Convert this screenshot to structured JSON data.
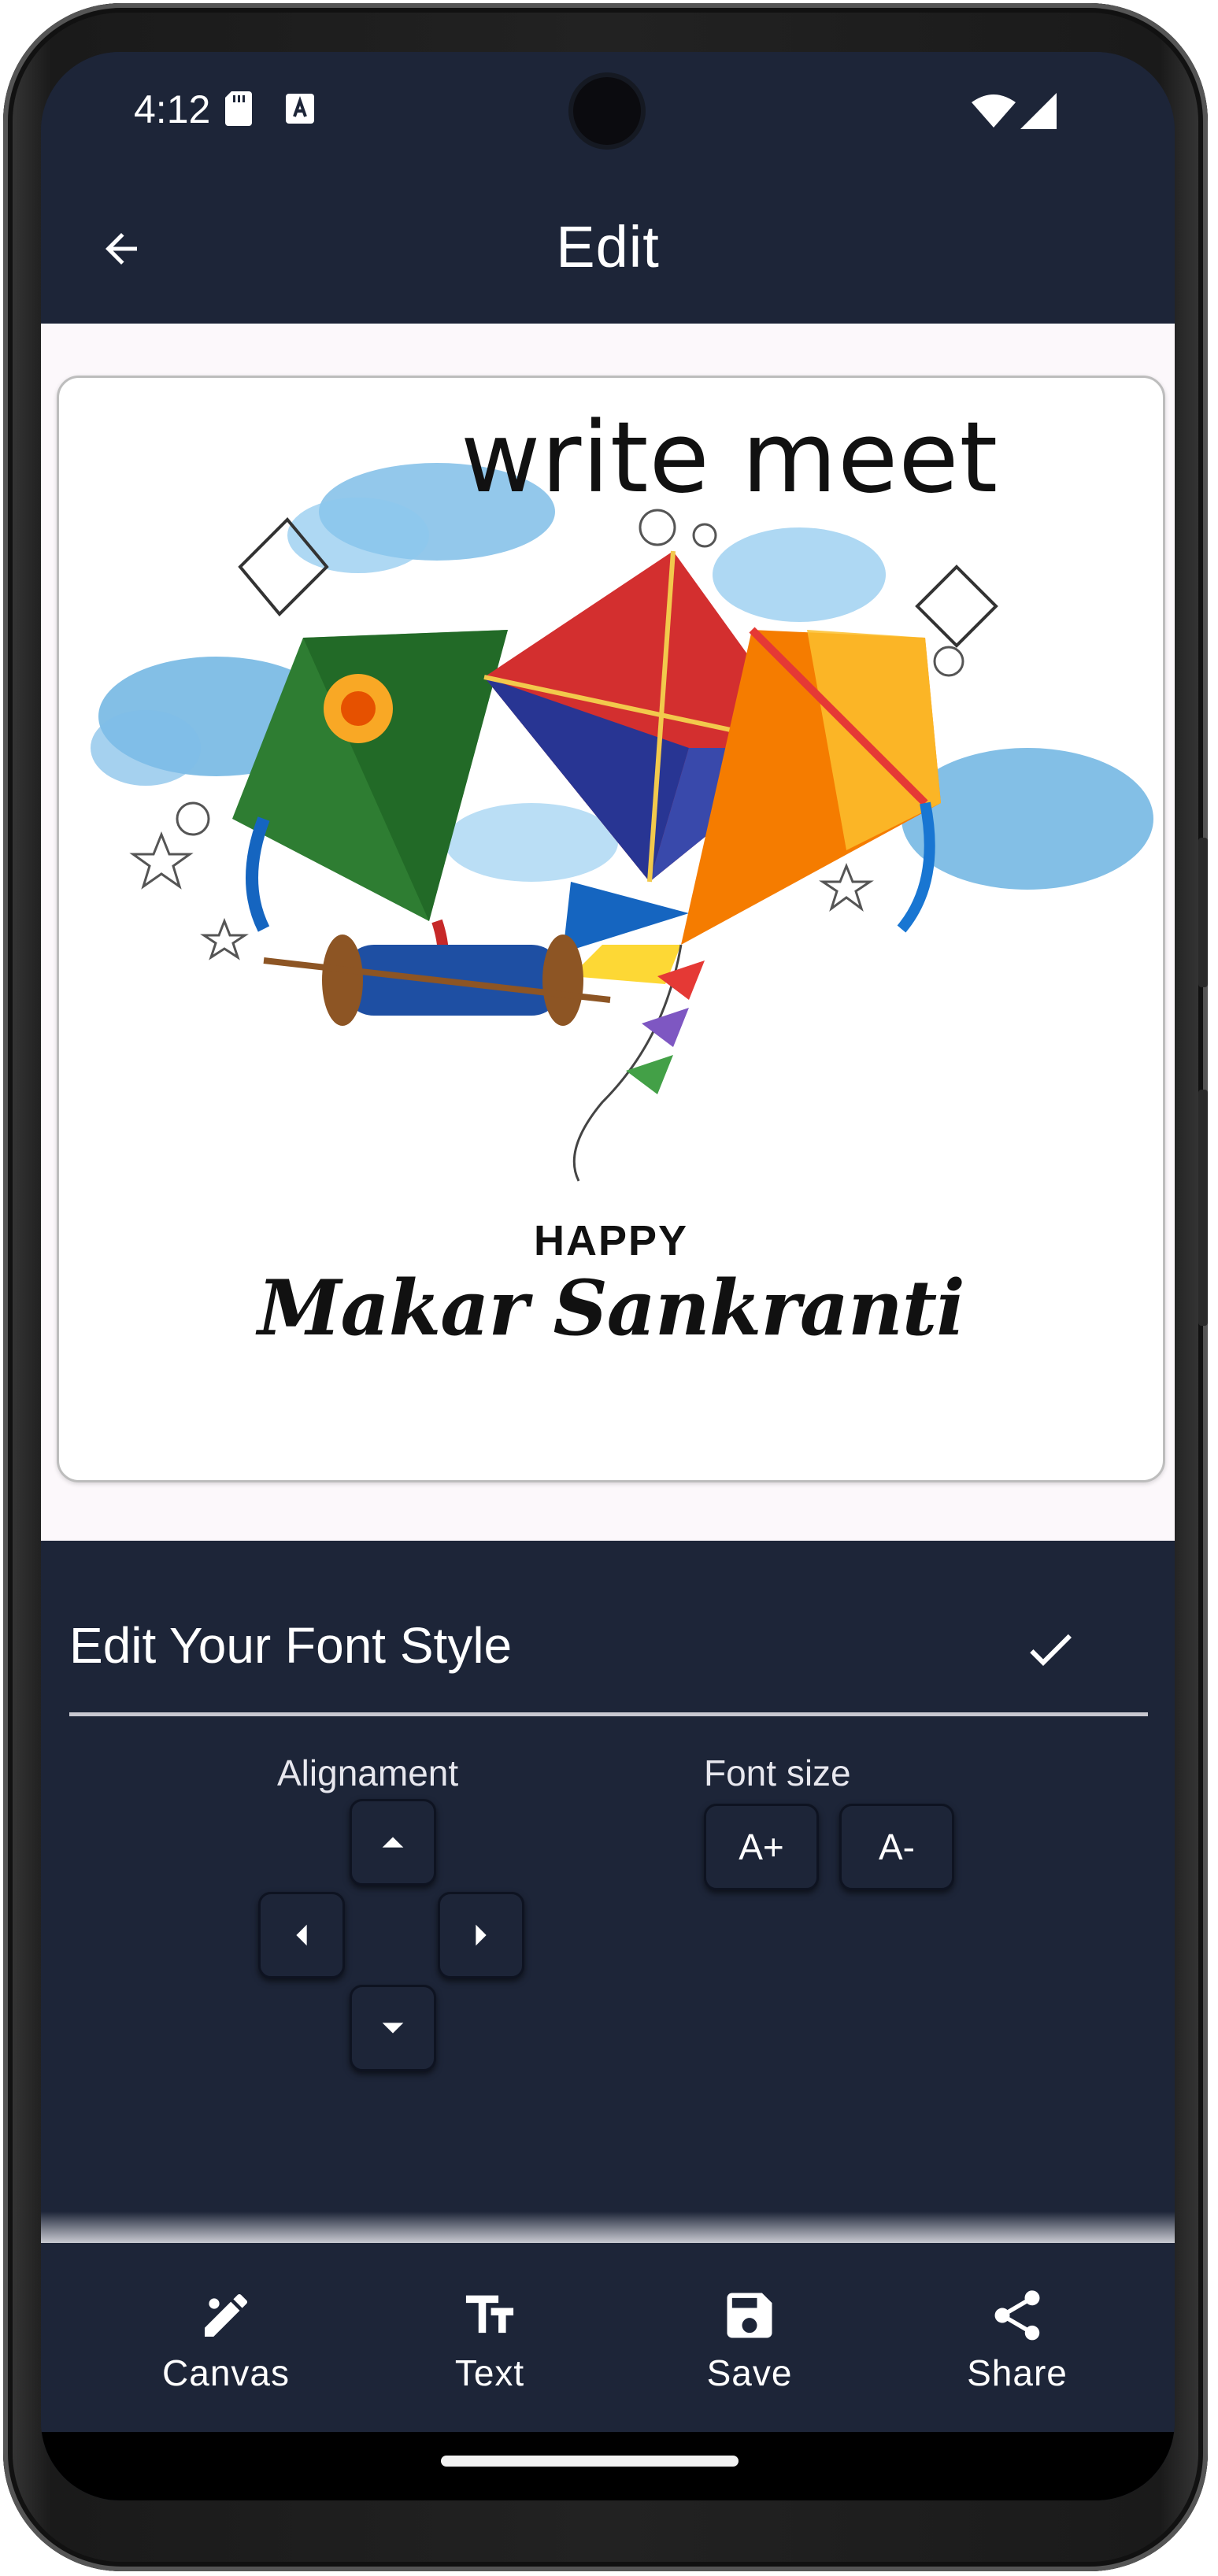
{
  "status_bar": {
    "time": "4:12",
    "icons": [
      "sd-card-icon",
      "a-badge-icon",
      "wifi-icon",
      "cell-signal-icon"
    ]
  },
  "app_bar": {
    "title": "Edit",
    "back_icon": "arrow-left-icon"
  },
  "card": {
    "overlay_text": "write meet",
    "greeting_line1": "HAPPY",
    "greeting_line2": "Makar Sankranti"
  },
  "sheet": {
    "title": "Edit Your Font Style",
    "confirm_icon": "check-icon",
    "alignment_label": "Alignament",
    "alignment_buttons": [
      "arrow-up-icon",
      "arrow-left-icon",
      "arrow-right-icon",
      "arrow-down-icon"
    ],
    "font_size_label": "Font size",
    "increase_label": "A+",
    "decrease_label": "A-"
  },
  "bottom_nav": {
    "items": [
      {
        "label": "Canvas",
        "icon": "draw-icon"
      },
      {
        "label": "Text",
        "icon": "text-fields-icon"
      },
      {
        "label": "Save",
        "icon": "save-icon"
      },
      {
        "label": "Share",
        "icon": "share-icon"
      }
    ]
  },
  "colors": {
    "primary_dark": "#1d2538",
    "background": "#fcf8fb",
    "card": "#ffffff"
  }
}
